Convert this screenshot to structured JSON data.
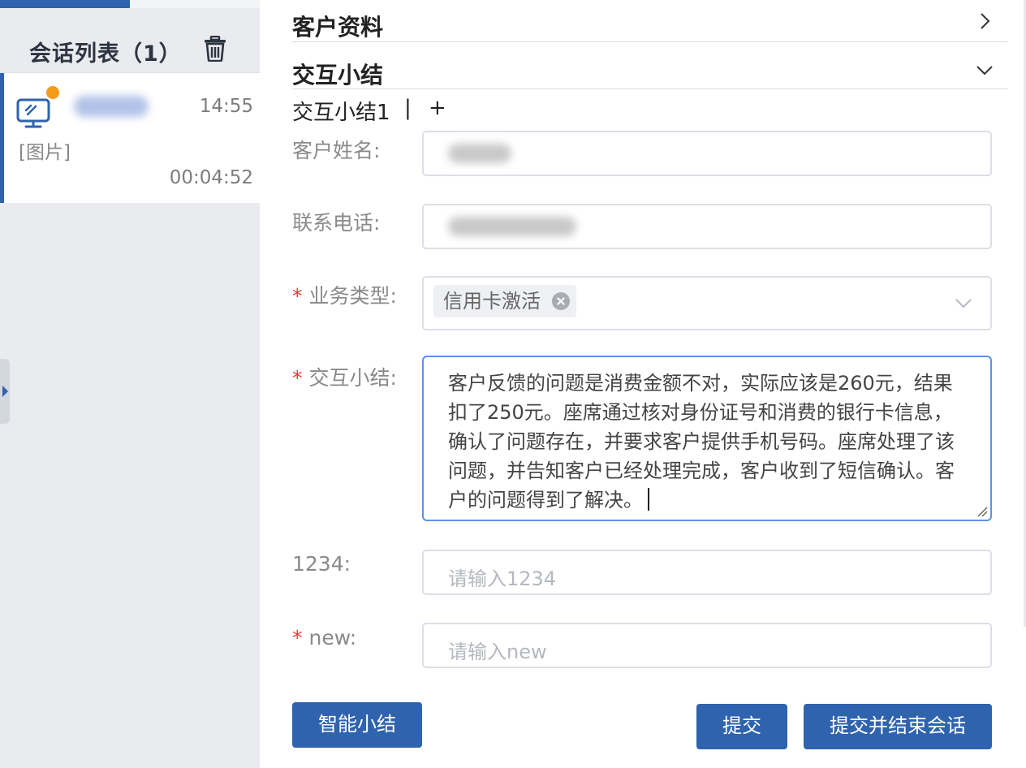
{
  "sidebar": {
    "list_title": "会话列表（1）",
    "session": {
      "time": "14:55",
      "preview": "[图片]",
      "duration": "00:04:52",
      "unread_dot_color": "#f59a1b",
      "icon": "monitor-icon"
    }
  },
  "sections": {
    "customer_info": "客户资料",
    "interaction_summary": "交互小结"
  },
  "subtabs": {
    "first": "交互小结1",
    "separator": "|",
    "add": "+"
  },
  "form": {
    "customer_name_label": "客户姓名:",
    "phone_label": "联系电话:",
    "business_type_label": "业务类型:",
    "business_type_tag": "信用卡激活",
    "summary_label": "交互小结:",
    "summary_text": "客户反馈的问题是消费金额不对，实际应该是260元，结果扣了250元。座席通过核对身份证号和消费的银行卡信息，确认了问题存在，并要求客户提供手机号码。座席处理了该问题，并告知客户已经处理完成，客户收到了短信确认。客户的问题得到了解决。",
    "field_1234_label": "1234:",
    "field_1234_placeholder": "请输入1234",
    "field_new_label": "new:",
    "field_new_placeholder": "请输入new",
    "required_mark": "*"
  },
  "buttons": {
    "smart_summary": "智能小结",
    "submit": "提交",
    "submit_and_end": "提交并结束会话"
  },
  "colors": {
    "primary": "#2f63ad",
    "required": "#ea3a3a",
    "focus_border": "#5b93e6"
  }
}
